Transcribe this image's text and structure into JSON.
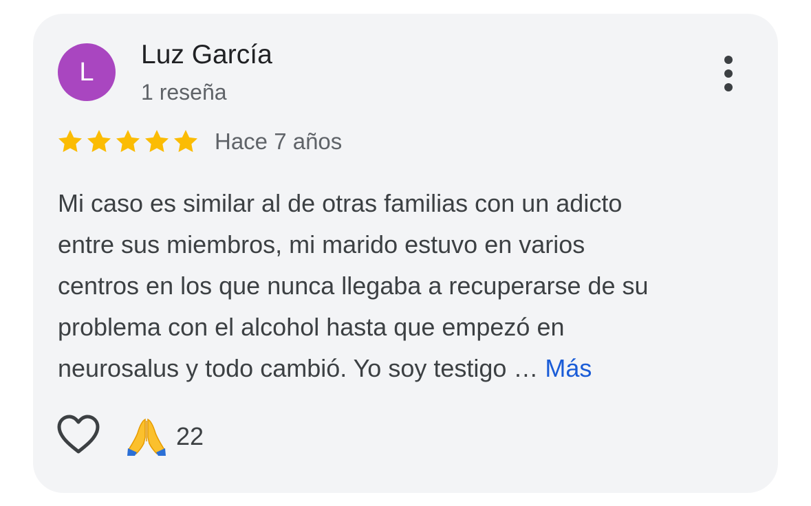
{
  "review": {
    "author": {
      "initial": "L",
      "name": "Luz García",
      "review_count": "1 reseña",
      "avatar_color": "#a946c0"
    },
    "rating": 5,
    "max_rating": 5,
    "star_color": "#fbbc04",
    "date": "Hace 7 años",
    "text_lines": [
      "Mi caso es similar al de otras familias con un adicto",
      "entre sus miembros, mi marido estuvo en varios",
      "centros en los que nunca llegaba a recuperarse de su",
      "problema con el alcohol hasta que empezó en",
      "neurosalus y todo cambió. Yo soy testigo …"
    ],
    "more_label": "Más",
    "link_color": "#1a5cd7",
    "reactions": {
      "like_icon": "heart-outline-icon",
      "emoji": "🙏",
      "emoji_name": "folded-hands-emoji",
      "count": "22"
    }
  }
}
